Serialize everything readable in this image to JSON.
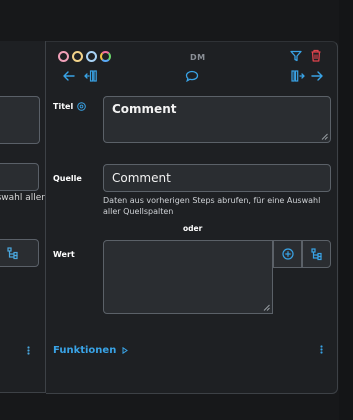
{
  "left_card": {
    "hint_fragment": "Daten aus vorherigen Steps abrufen, für eine Auswahl aller"
  },
  "card": {
    "initials": "DM",
    "circle_colors": [
      "#f0a0b8",
      "#f2d38a",
      "#a9d3f5",
      "multicolor"
    ],
    "icons": {
      "filter": "filter-icon",
      "trash": "trash-icon",
      "toolbar": [
        "arrow-left-icon",
        "insert-step-left-icon",
        "comment-icon",
        "insert-step-right-icon",
        "arrow-right-icon"
      ]
    },
    "fields": {
      "title_label": "Titel",
      "title_value": "Comment",
      "source_label": "Quelle",
      "source_value": "Comment",
      "source_hint": "Daten aus vorherigen Steps abrufen, für eine Auswahl aller Quellspalten",
      "or_label": "oder",
      "value_label": "Wert",
      "value_value": ""
    },
    "functions_label": "Funktionen"
  },
  "colors": {
    "accent": "#39a3e6",
    "danger": "#e0434d",
    "background": "#1e2023"
  }
}
